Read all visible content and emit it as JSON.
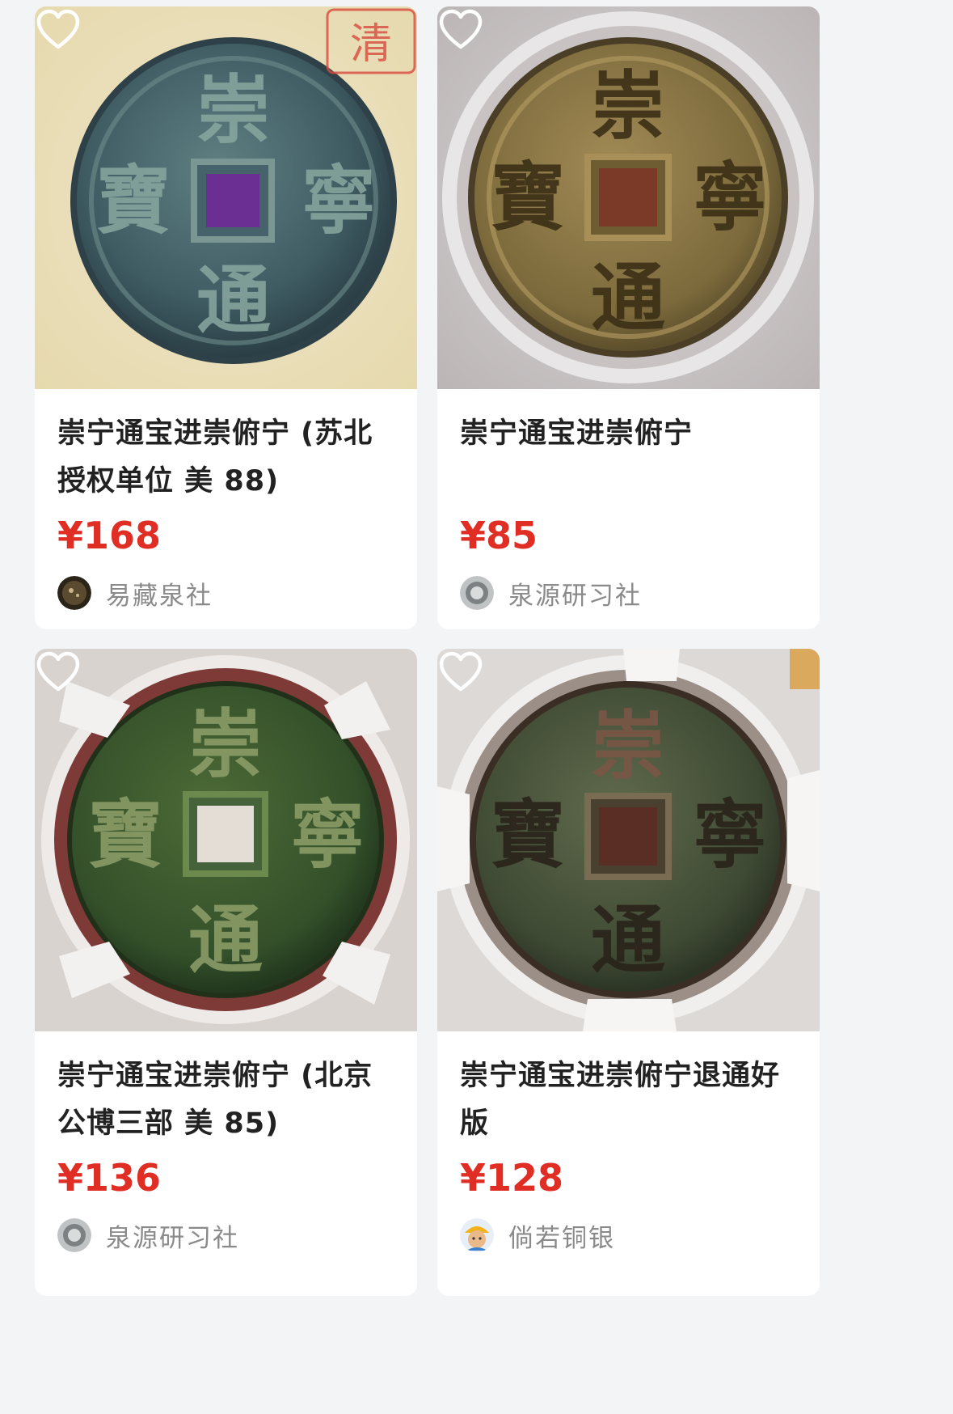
{
  "products": [
    {
      "title": "崇宁通宝进崇俯宁 (苏北授权单位 美 88)",
      "price": "¥168",
      "shop": "易藏泉社",
      "coin_chars": {
        "top": "崇",
        "right": "寧",
        "bottom": "通",
        "left": "寶"
      },
      "stamp_text": "清"
    },
    {
      "title": "崇宁通宝进崇俯宁",
      "price": "¥85",
      "shop": "泉源研习社",
      "coin_chars": {
        "top": "崇",
        "right": "寧",
        "bottom": "通",
        "left": "寶"
      }
    },
    {
      "title": "崇宁通宝进崇俯宁 (北京公博三部 美 85)",
      "price": "¥136",
      "shop": "泉源研习社",
      "coin_chars": {
        "top": "崇",
        "right": "寧",
        "bottom": "通",
        "left": "寶"
      }
    },
    {
      "title": "崇宁通宝进崇俯宁退通好版",
      "price": "¥128",
      "shop": "倘若铜银",
      "coin_chars": {
        "top": "崇",
        "right": "寧",
        "bottom": "通",
        "left": "寶"
      }
    }
  ],
  "icons": {
    "favorite": "heart-outline-icon"
  },
  "colors": {
    "price": "#e02e24",
    "title": "#222222",
    "shop": "#8a8a8a",
    "page_bg": "#f3f4f6"
  }
}
